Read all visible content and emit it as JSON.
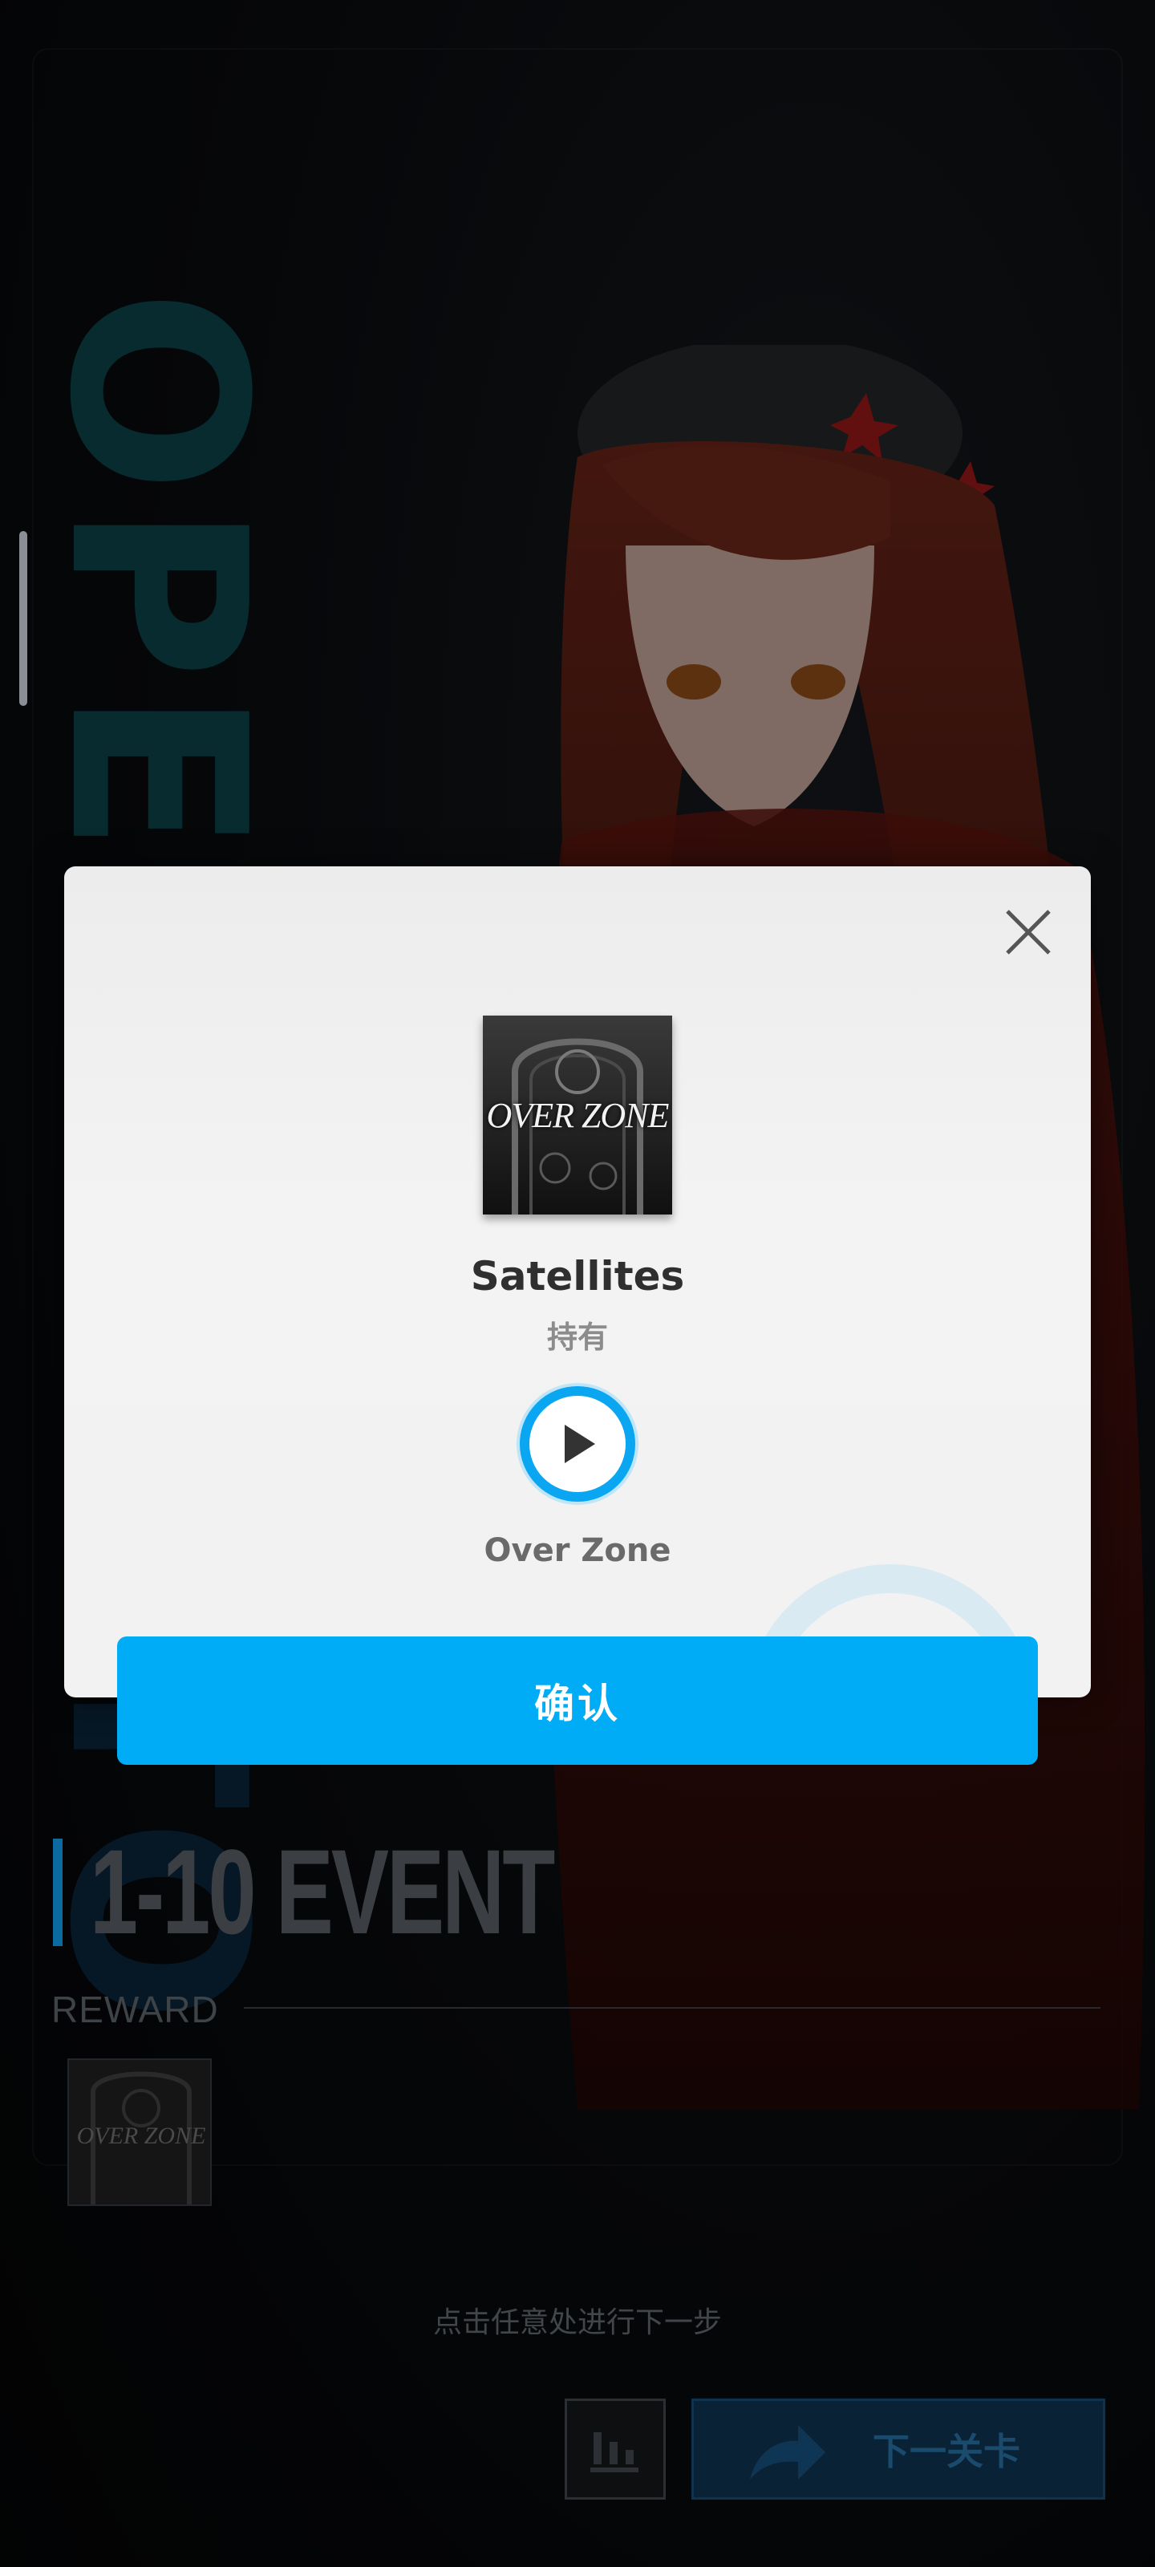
{
  "background": {
    "vertical_text": "OPERA",
    "vertical_text_lower": "TO"
  },
  "stage": {
    "title": "1-10 EVENT",
    "reward_label": "REWARD",
    "reward_item_label": "OVER ZONE"
  },
  "hint": "点击任意处进行下一步",
  "buttons": {
    "stats_icon": "bar-chart-icon",
    "next_stage_label": "下一关卡"
  },
  "modal": {
    "album_logo": "OVER ZONE",
    "song_title": "Satellites",
    "owned_status": "持有",
    "artist": "Over Zone",
    "confirm_label": "确认",
    "close_icon": "close-icon",
    "play_icon": "play-icon"
  },
  "colors": {
    "accent": "#00acf5",
    "play_ring": "#0aa6f2",
    "bg_text": "#0e4f57"
  }
}
